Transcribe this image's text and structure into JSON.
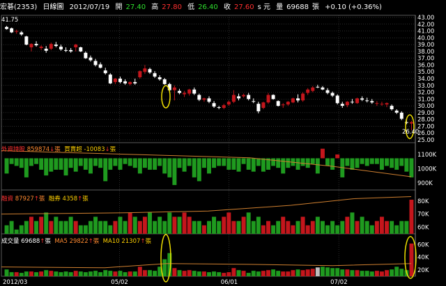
{
  "header": {
    "name": "宏碁(2353)",
    "period": "日線圖",
    "date": "2012/07/19",
    "open_label": "開",
    "open": "27.40",
    "high_label": "高",
    "high": "27.80",
    "low_label": "低",
    "low": "26.40",
    "close_label": "收",
    "close": "27.60",
    "close_unit": "s 元",
    "vol_label": "量",
    "volume": "69688",
    "vol_unit": "張",
    "change": "+0.10 (+0.36%)"
  },
  "panels": {
    "foreign": {
      "label": "外資持股",
      "value": "859874",
      "arrow": "↓",
      "unit": "張",
      "label2": "買賣超",
      "value2": "-10083",
      "arrow2": "↓",
      "unit2": "張"
    },
    "margin": {
      "label": "融資",
      "value": "87927",
      "arrow": "↑",
      "unit": "張",
      "label2": "融券",
      "value2": "4358",
      "arrow2": "↑",
      "unit2": "張"
    },
    "volume": {
      "label": "成交量",
      "value": "69688",
      "arrow": "↑",
      "unit": "張",
      "label2": "MA5",
      "value2": "29822",
      "arrow2": "↑",
      "unit2": "張",
      "label3": "MA10",
      "value3": "21307",
      "arrow3": "↑",
      "unit3": "張"
    }
  },
  "annotations": {
    "high_mark": "41.75",
    "low_mark": "26.40"
  },
  "colors": {
    "up": "#c4161c",
    "down": "#ffffff",
    "green_bar": "#1f9a1f",
    "grid": "#5a5a5a",
    "ma": "#d08030",
    "circle": "#f0e000",
    "gray_bar": "#bdbdbd"
  },
  "chart_data": [
    {
      "type": "candlestick",
      "title": "",
      "x_dates": [
        "2012/03",
        "05/02",
        "06/01",
        "07/02"
      ],
      "ylim": [
        25,
        43
      ],
      "y_ticks": [
        "25.00",
        "26.00",
        "27.00",
        "28.00",
        "29.00",
        "30.00",
        "31.00",
        "32.00",
        "33.00",
        "34.00",
        "35.00",
        "36.00",
        "37.00",
        "38.00",
        "39.00",
        "40.00",
        "41.00",
        "42.00",
        "43.00"
      ],
      "ohlc": [
        [
          41.6,
          41.75,
          41.2,
          41.3
        ],
        [
          41.4,
          41.5,
          40.7,
          40.8
        ],
        [
          41.0,
          41.2,
          40.6,
          41.0
        ],
        [
          40.8,
          41.0,
          40.3,
          40.5
        ],
        [
          40.2,
          40.3,
          38.9,
          39.0
        ],
        [
          38.6,
          39.2,
          38.0,
          39.1
        ],
        [
          39.1,
          39.5,
          38.7,
          38.9
        ],
        [
          38.5,
          38.9,
          38.2,
          38.7
        ],
        [
          38.4,
          38.8,
          37.8,
          38.1
        ],
        [
          38.4,
          39.3,
          38.2,
          39.1
        ],
        [
          39.0,
          39.4,
          38.6,
          38.8
        ],
        [
          38.7,
          39.0,
          38.1,
          38.3
        ],
        [
          38.2,
          38.6,
          37.9,
          38.1
        ],
        [
          38.2,
          38.5,
          37.8,
          38.0
        ],
        [
          38.6,
          39.1,
          38.0,
          39.0
        ],
        [
          38.6,
          38.7,
          37.9,
          38.0
        ],
        [
          37.8,
          38.0,
          36.9,
          37.0
        ],
        [
          37.1,
          37.4,
          36.5,
          36.7
        ],
        [
          36.6,
          36.9,
          35.8,
          36.0
        ],
        [
          36.1,
          36.4,
          35.5,
          35.6
        ],
        [
          35.2,
          35.6,
          34.6,
          34.8
        ],
        [
          34.6,
          34.8,
          33.2,
          33.3
        ],
        [
          33.5,
          34.1,
          33.2,
          34.0
        ],
        [
          34.0,
          34.3,
          33.3,
          33.5
        ],
        [
          33.6,
          33.9,
          33.1,
          33.3
        ],
        [
          33.2,
          33.6,
          33.0,
          33.5
        ],
        [
          33.5,
          34.0,
          33.1,
          33.3
        ],
        [
          34.2,
          35.2,
          34.0,
          35.1
        ],
        [
          35.0,
          36.0,
          34.7,
          35.5
        ],
        [
          35.4,
          35.6,
          34.7,
          34.9
        ],
        [
          34.8,
          35.1,
          34.1,
          34.3
        ],
        [
          34.2,
          34.5,
          33.7,
          33.9
        ],
        [
          33.9,
          34.1,
          33.1,
          33.2
        ],
        [
          33.2,
          33.4,
          32.2,
          32.3
        ],
        [
          32.3,
          33.0,
          30.8,
          32.7
        ],
        [
          32.2,
          32.5,
          31.7,
          31.9
        ],
        [
          31.7,
          32.2,
          31.3,
          31.9
        ],
        [
          31.8,
          32.5,
          31.5,
          32.4
        ],
        [
          32.4,
          32.7,
          31.6,
          31.8
        ],
        [
          31.6,
          31.8,
          30.7,
          30.9
        ],
        [
          30.9,
          31.2,
          30.6,
          31.1
        ],
        [
          31.1,
          31.4,
          30.4,
          30.6
        ],
        [
          30.4,
          30.7,
          29.7,
          29.9
        ],
        [
          29.8,
          30.0,
          29.5,
          29.7
        ],
        [
          29.7,
          30.3,
          29.5,
          30.1
        ],
        [
          30.2,
          30.8,
          30.0,
          30.6
        ],
        [
          30.6,
          32.3,
          30.4,
          31.6
        ],
        [
          31.4,
          31.8,
          30.8,
          31.1
        ],
        [
          31.4,
          31.8,
          31.2,
          31.6
        ],
        [
          31.6,
          31.9,
          30.8,
          31.0
        ],
        [
          30.7,
          31.1,
          30.4,
          30.6
        ],
        [
          30.3,
          30.6,
          28.9,
          29.2
        ],
        [
          29.7,
          30.6,
          29.5,
          30.5
        ],
        [
          30.5,
          31.9,
          30.3,
          31.6
        ],
        [
          31.6,
          31.7,
          30.9,
          31.0
        ],
        [
          30.7,
          30.8,
          29.9,
          30.0
        ],
        [
          30.1,
          30.4,
          29.7,
          30.2
        ],
        [
          30.2,
          30.7,
          30.0,
          30.6
        ],
        [
          30.5,
          31.2,
          30.4,
          31.1
        ],
        [
          31.1,
          31.7,
          30.5,
          30.8
        ],
        [
          30.8,
          32.0,
          30.6,
          31.8
        ],
        [
          31.9,
          32.6,
          31.6,
          32.4
        ],
        [
          32.2,
          32.9,
          32.0,
          32.7
        ],
        [
          32.8,
          33.1,
          32.6,
          32.7
        ],
        [
          32.7,
          32.9,
          32.3,
          32.4
        ],
        [
          32.3,
          32.6,
          31.7,
          31.9
        ],
        [
          31.9,
          32.1,
          31.3,
          31.5
        ],
        [
          31.5,
          31.7,
          30.2,
          30.4
        ],
        [
          30.3,
          30.6,
          29.7,
          30.0
        ],
        [
          30.1,
          30.7,
          29.8,
          30.6
        ],
        [
          30.6,
          31.0,
          30.3,
          30.5
        ],
        [
          30.4,
          31.2,
          30.3,
          31.1
        ],
        [
          31.1,
          31.4,
          30.7,
          30.9
        ],
        [
          30.8,
          31.2,
          30.5,
          30.7
        ],
        [
          30.7,
          31.0,
          30.3,
          30.5
        ],
        [
          30.3,
          30.7,
          30.0,
          30.4
        ],
        [
          30.3,
          30.6,
          30.0,
          30.3
        ],
        [
          30.2,
          30.5,
          29.8,
          30.4
        ],
        [
          30.0,
          30.2,
          29.3,
          29.5
        ],
        [
          29.3,
          29.5,
          28.8,
          29.0
        ],
        [
          29.0,
          29.2,
          27.9,
          28.1
        ],
        [
          27.6,
          28.0,
          27.3,
          27.5
        ],
        [
          27.4,
          27.8,
          26.4,
          27.6
        ]
      ]
    },
    {
      "type": "bar",
      "title": "外資持股",
      "values": [
        -8,
        -3,
        -4,
        -5,
        -10,
        -4,
        -3,
        -6,
        -9,
        -7,
        -6,
        -6,
        -9,
        -5,
        -7,
        -4,
        -6,
        -8,
        -4,
        -5,
        -12,
        -6,
        -4,
        -6,
        -3,
        -4,
        -5,
        -8,
        -5,
        -6,
        -6,
        -4,
        -8,
        -10,
        -14,
        -5,
        -7,
        -4,
        -10,
        -12,
        -5,
        -8,
        -5,
        -4,
        -4,
        -6,
        -6,
        -7,
        -3,
        -6,
        -7,
        -4,
        -7,
        -6,
        -4,
        -5,
        -8,
        -5,
        -4,
        -6,
        -4,
        -5,
        -3,
        -8,
        5,
        -4,
        -6,
        2,
        -10,
        -4,
        -6,
        -5,
        -3,
        -4,
        -3,
        -3,
        -6,
        -4,
        -5,
        -6,
        -4,
        -7,
        -10
      ],
      "labels": [
        "1100K",
        "1000K",
        "900K"
      ]
    },
    {
      "type": "bar",
      "title": "融資",
      "values": [
        2,
        3,
        -1,
        2,
        3,
        4,
        3,
        4,
        5,
        3,
        4,
        3,
        3,
        4,
        3,
        2,
        2,
        3,
        4,
        3,
        3,
        2,
        3,
        4,
        3,
        5,
        4,
        3,
        4,
        5,
        3,
        4,
        3,
        5,
        4,
        4,
        5,
        4,
        3,
        3,
        2,
        -3,
        4,
        3,
        4,
        5,
        3,
        3,
        4,
        5,
        3,
        4,
        2,
        3,
        2,
        3,
        4,
        3,
        2,
        3,
        4,
        2,
        3,
        4,
        3,
        2,
        3,
        2,
        3,
        4,
        5,
        3,
        4,
        3,
        2,
        3,
        4,
        3,
        3,
        2,
        3,
        3,
        8
      ],
      "labels": [
        "80K",
        "70K",
        "60K"
      ]
    },
    {
      "type": "bar",
      "title": "成交量",
      "values": [
        10,
        6,
        6,
        5,
        7,
        7,
        6,
        7,
        9,
        8,
        7,
        6,
        7,
        6,
        8,
        7,
        6,
        7,
        8,
        6,
        9,
        8,
        7,
        8,
        6,
        7,
        7,
        14,
        9,
        9,
        8,
        14,
        25,
        34,
        12,
        9,
        8,
        9,
        8,
        7,
        7,
        6,
        7,
        6,
        5,
        6,
        12,
        9,
        8,
        5,
        8,
        7,
        8,
        9,
        10,
        8,
        7,
        7,
        9,
        10,
        9,
        10,
        11,
        13,
        14,
        13,
        12,
        12,
        10,
        10,
        9,
        9,
        8,
        8,
        7,
        8,
        7,
        9,
        10,
        14,
        11,
        9,
        48
      ],
      "labels": [
        "60K",
        "40K",
        "20K"
      ]
    }
  ]
}
